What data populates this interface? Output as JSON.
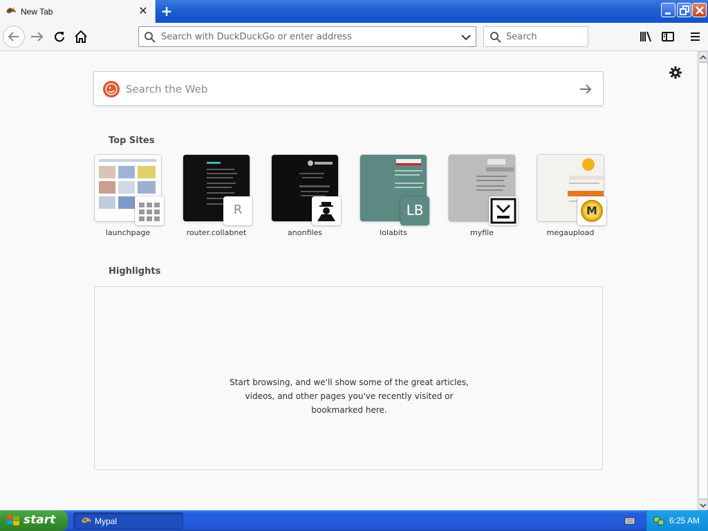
{
  "tab": {
    "title": "New Tab"
  },
  "toolbar": {
    "url_placeholder": "Search with DuckDuckGo or enter address",
    "search_placeholder": "Search"
  },
  "newtab": {
    "web_search_placeholder": "Search the Web",
    "top_sites_heading": "Top Sites",
    "top_sites": [
      {
        "label": "launchpage",
        "badge": "grid"
      },
      {
        "label": "router.collabnet",
        "badge": "R"
      },
      {
        "label": "anonfiles",
        "badge": "anon"
      },
      {
        "label": "lolabits",
        "badge": "LB"
      },
      {
        "label": "myfile",
        "badge": "myfile"
      },
      {
        "label": "megaupload",
        "badge": "M"
      }
    ],
    "highlights_heading": "Highlights",
    "highlights_empty": "Start browsing, and we'll show some of the great articles, videos, and other pages you've recently visited or bookmarked here."
  },
  "taskbar": {
    "start_label": "start",
    "task_label": "Mypal",
    "clock": "6:25 AM"
  },
  "colors": {
    "titlebar": "#1d5fd0",
    "start_green": "#36932f",
    "tray": "#0f8bd8"
  }
}
